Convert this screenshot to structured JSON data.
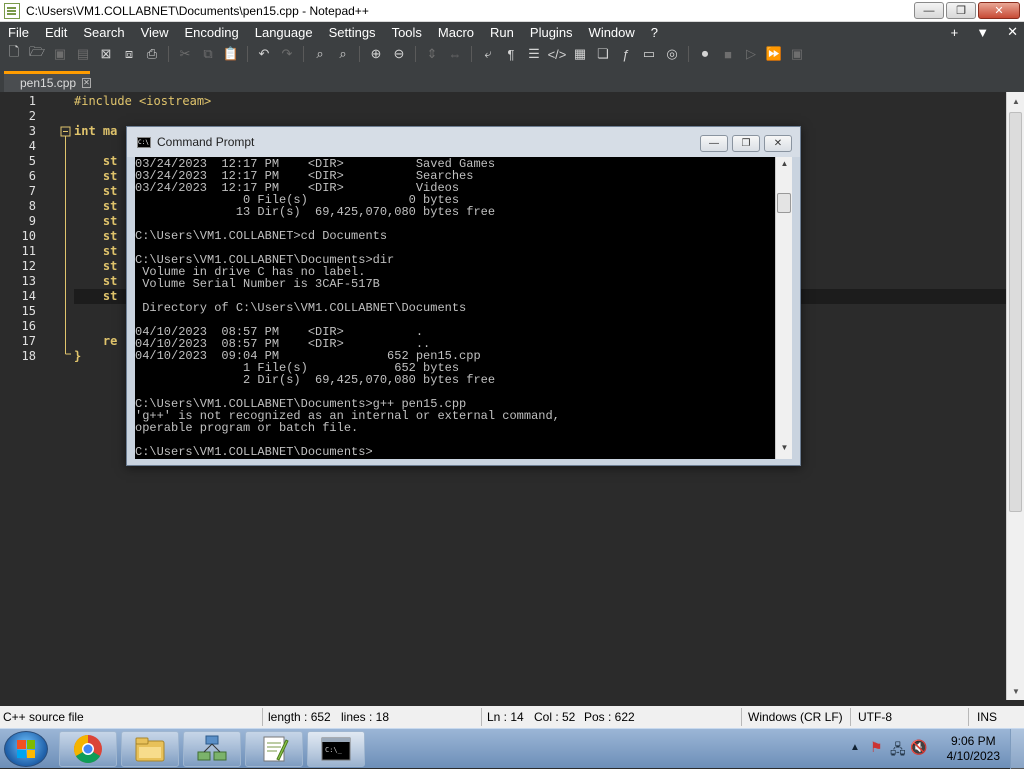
{
  "window": {
    "title": "C:\\Users\\VM1.COLLABNET\\Documents\\pen15.cpp - Notepad++",
    "minimize": "—",
    "maximize": "❐",
    "close": "✕"
  },
  "menu": {
    "items": [
      "File",
      "Edit",
      "Search",
      "View",
      "Encoding",
      "Language",
      "Settings",
      "Tools",
      "Macro",
      "Run",
      "Plugins",
      "Window",
      "?"
    ],
    "right": [
      "+",
      "▼",
      "✕"
    ]
  },
  "toolbar": {
    "icons": [
      "new-file-icon",
      "open-file-icon",
      "save-icon",
      "save-all-icon",
      "close-icon",
      "close-all-icon",
      "print-icon",
      "cut-icon",
      "copy-icon",
      "paste-icon",
      "undo-icon",
      "redo-icon",
      "find-icon",
      "replace-icon",
      "zoom-in-icon",
      "zoom-out-icon",
      "sync-vertical-icon",
      "sync-horizontal-icon",
      "word-wrap-icon",
      "show-all-chars-icon",
      "indent-guide-icon",
      "udl-icon",
      "doc-map-icon",
      "function-list-icon",
      "folder-workspace-icon",
      "monitoring-icon",
      "record-macro-icon",
      "stop-macro-icon",
      "play-macro-icon",
      "run-multiple-icon",
      "save-macro-icon"
    ]
  },
  "tab": {
    "label": "pen15.cpp",
    "close": "✕"
  },
  "editor": {
    "line_numbers": [
      "1",
      "2",
      "3",
      "4",
      "5",
      "6",
      "7",
      "8",
      "9",
      "10",
      "11",
      "12",
      "13",
      "14",
      "15",
      "16",
      "17",
      "18"
    ],
    "lines": [
      {
        "n": 1,
        "kw": "#include",
        "rest": " <iostream>"
      },
      {
        "n": 3,
        "kw": "int",
        "rest": " ma"
      },
      {
        "n": 5,
        "kw": "",
        "rest": "    st"
      },
      {
        "n": 6,
        "kw": "",
        "rest": "    st"
      },
      {
        "n": 7,
        "kw": "",
        "rest": "    st"
      },
      {
        "n": 8,
        "kw": "",
        "rest": "    st"
      },
      {
        "n": 9,
        "kw": "",
        "rest": "    st"
      },
      {
        "n": 10,
        "kw": "",
        "rest": "    st"
      },
      {
        "n": 11,
        "kw": "",
        "rest": "    st"
      },
      {
        "n": 12,
        "kw": "",
        "rest": "    st"
      },
      {
        "n": 13,
        "kw": "",
        "rest": "    st"
      },
      {
        "n": 14,
        "kw": "",
        "rest": "    st"
      },
      {
        "n": 17,
        "kw": "",
        "rest": "    re"
      },
      {
        "n": 18,
        "kw": "",
        "rest": "}"
      }
    ]
  },
  "status": {
    "file_type": "C++ source file",
    "length": "length : 652",
    "lines": "lines : 18",
    "ln": "Ln : 14",
    "col": "Col : 52",
    "pos": "Pos : 622",
    "eol": "Windows (CR LF)",
    "encoding": "UTF-8",
    "mode": "INS"
  },
  "cmd": {
    "title": "Command Prompt",
    "icon_text": "C:\\",
    "lines": [
      "03/24/2023  12:17 PM    <DIR>          Saved Games",
      "03/24/2023  12:17 PM    <DIR>          Searches",
      "03/24/2023  12:17 PM    <DIR>          Videos",
      "               0 File(s)              0 bytes",
      "              13 Dir(s)  69,425,070,080 bytes free",
      "",
      "C:\\Users\\VM1.COLLABNET>cd Documents",
      "",
      "C:\\Users\\VM1.COLLABNET\\Documents>dir",
      " Volume in drive C has no label.",
      " Volume Serial Number is 3CAF-517B",
      "",
      " Directory of C:\\Users\\VM1.COLLABNET\\Documents",
      "",
      "04/10/2023  08:57 PM    <DIR>          .",
      "04/10/2023  08:57 PM    <DIR>          ..",
      "04/10/2023  09:04 PM               652 pen15.cpp",
      "               1 File(s)            652 bytes",
      "               2 Dir(s)  69,425,070,080 bytes free",
      "",
      "C:\\Users\\VM1.COLLABNET\\Documents>g++ pen15.cpp",
      "'g++' is not recognized as an internal or external command,",
      "operable program or batch file.",
      "",
      "C:\\Users\\VM1.COLLABNET\\Documents>"
    ]
  },
  "taskbar": {
    "apps": [
      "chrome-icon",
      "explorer-icon",
      "network-app-icon",
      "notepadpp-icon",
      "cmd-icon"
    ],
    "time": "9:06 PM",
    "date": "4/10/2023"
  },
  "colors": {
    "editor_bg": "#2b2b2b",
    "keyword": "#e0c46c",
    "tab_accent": "#ff9c00",
    "cmd_text": "#c0c0c0"
  }
}
